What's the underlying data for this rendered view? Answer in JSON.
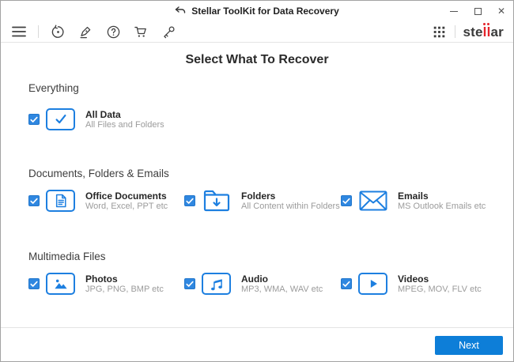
{
  "window": {
    "title": "Stellar ToolKit for Data Recovery",
    "controls": {
      "minimize": "minimize",
      "maximize": "maximize",
      "close": "✕"
    }
  },
  "toolbar": {
    "left_icon_names": [
      "menu-icon",
      "resume-recovery-icon",
      "activation-pen-icon",
      "help-icon",
      "buy-cart-icon",
      "license-key-icon"
    ],
    "right_icon_names": [
      "app-grid-icon"
    ],
    "logo": {
      "part1": "ste",
      "part2": "ll",
      "part3": "ar"
    }
  },
  "main": {
    "heading": "Select What To Recover",
    "sections": [
      {
        "title": "Everything",
        "items": [
          {
            "icon": "all-data",
            "title": "All Data",
            "subtitle": "All Files and Folders",
            "checked": true
          }
        ]
      },
      {
        "title": "Documents, Folders & Emails",
        "items": [
          {
            "icon": "office-documents",
            "title": "Office Documents",
            "subtitle": "Word, Excel, PPT etc",
            "checked": true
          },
          {
            "icon": "folders",
            "title": "Folders",
            "subtitle": "All Content within Folders",
            "checked": true
          },
          {
            "icon": "emails",
            "title": "Emails",
            "subtitle": "MS Outlook Emails etc",
            "checked": true
          }
        ]
      },
      {
        "title": "Multimedia Files",
        "items": [
          {
            "icon": "photos",
            "title": "Photos",
            "subtitle": "JPG, PNG, BMP etc",
            "checked": true
          },
          {
            "icon": "audio",
            "title": "Audio",
            "subtitle": "MP3, WMA, WAV etc",
            "checked": true
          },
          {
            "icon": "videos",
            "title": "Videos",
            "subtitle": "MPEG, MOV, FLV etc",
            "checked": true
          }
        ]
      }
    ]
  },
  "footer": {
    "next_label": "Next"
  },
  "colors": {
    "accent_blue": "#0d7ed8",
    "icon_blue": "#1d7fe0",
    "checkbox_blue": "#2f87e0",
    "logo_red": "#e4242b",
    "toolbar_icon_gray": "#3f3f3f"
  }
}
